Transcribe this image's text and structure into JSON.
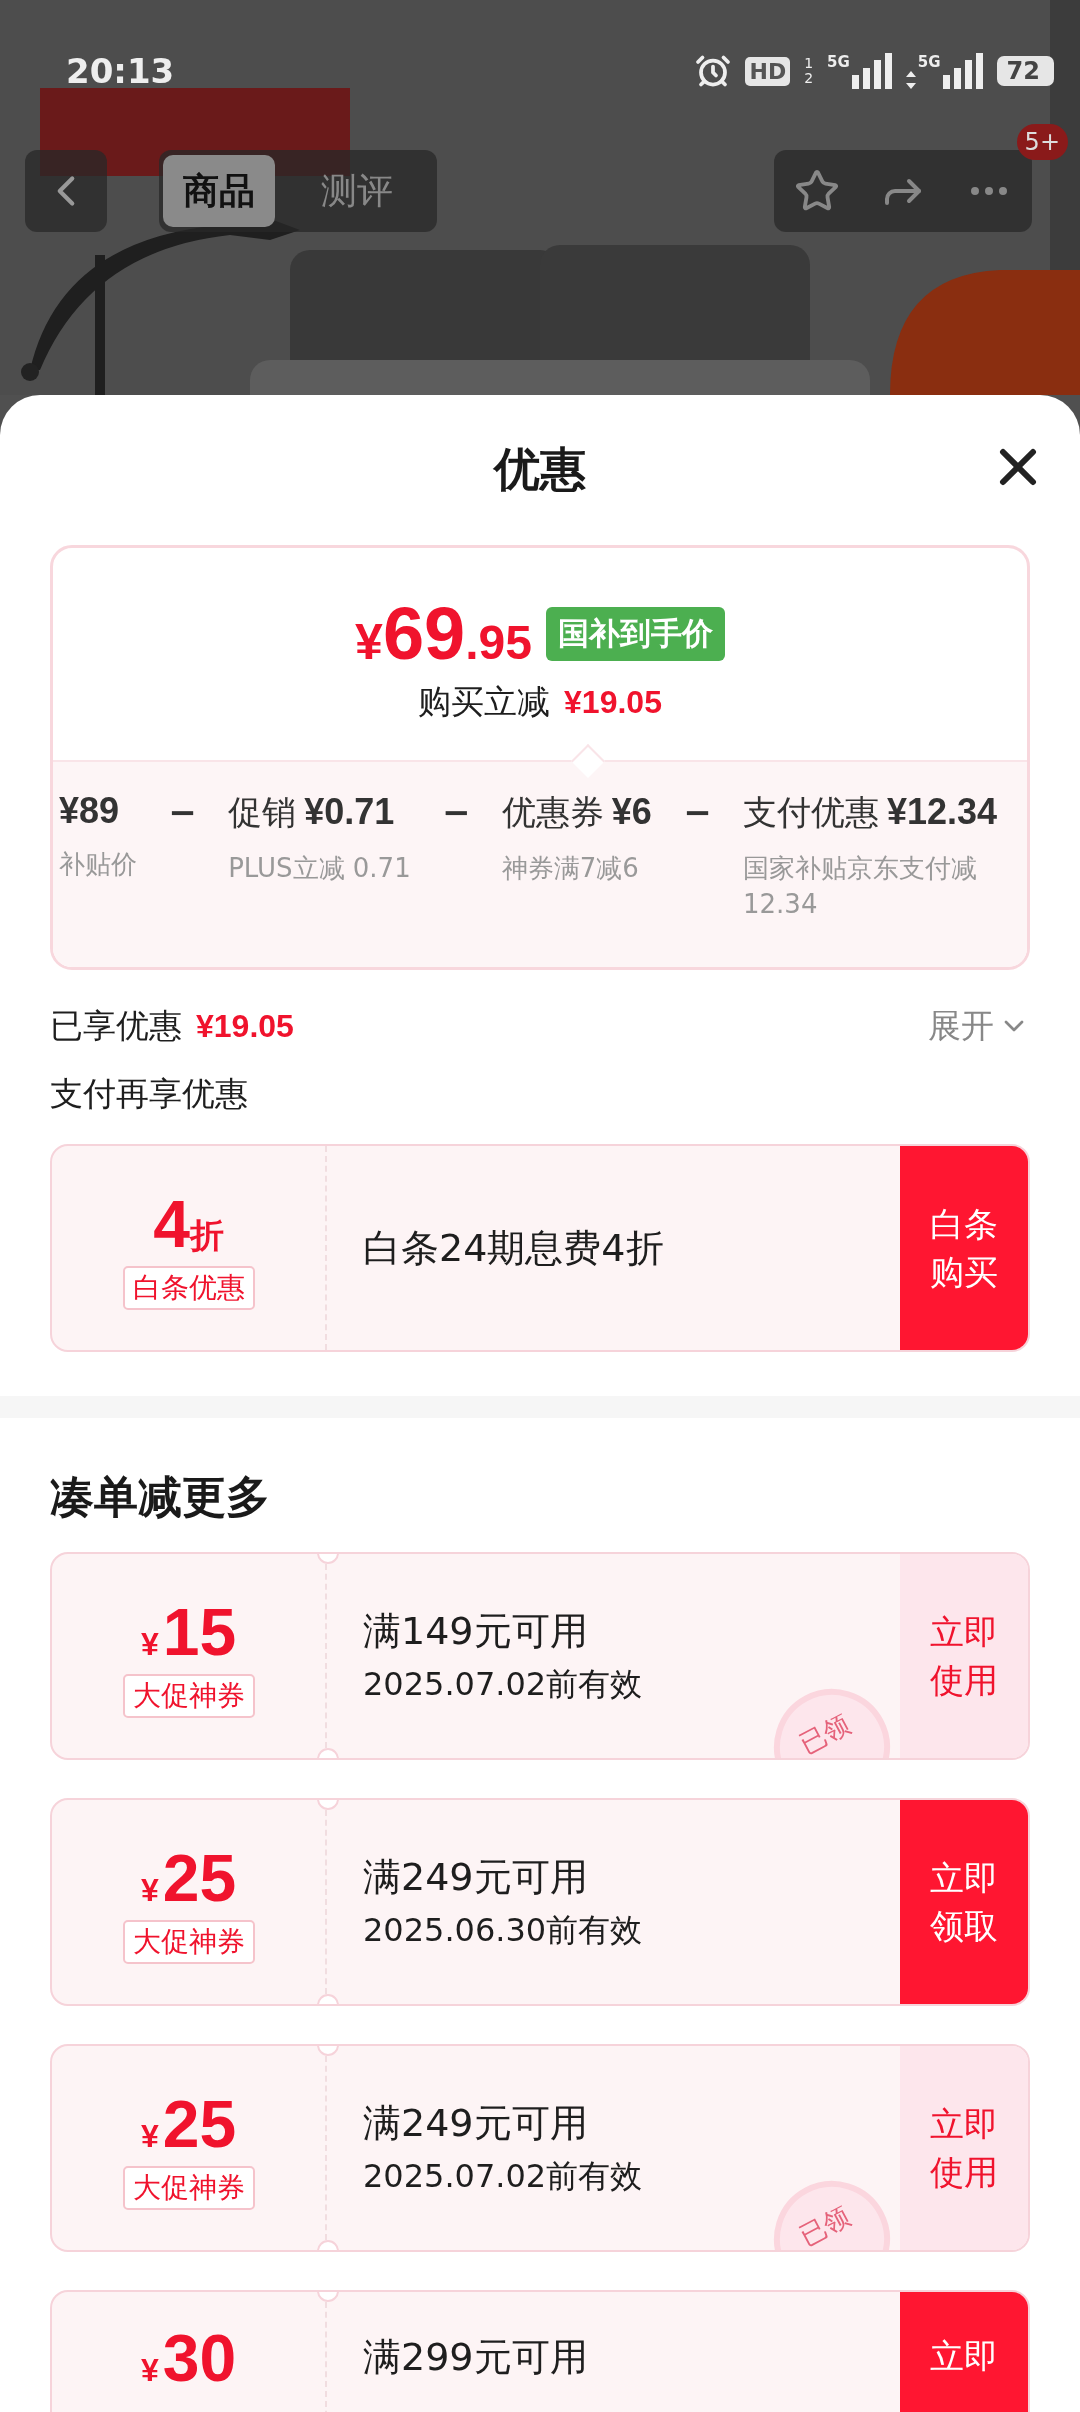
{
  "status_bar": {
    "time": "20:13",
    "hd": "HD",
    "hd_slots": [
      "1",
      "2"
    ],
    "networks": [
      {
        "label": "5G",
        "arrows": false
      },
      {
        "label": "5G",
        "arrows": true
      }
    ],
    "battery": "72"
  },
  "nav": {
    "tabs": [
      {
        "label": "商品",
        "selected": true
      },
      {
        "label": "测评",
        "selected": false
      }
    ],
    "badge": "5+"
  },
  "sheet": {
    "title": "优惠"
  },
  "price_card": {
    "currency": "¥",
    "price_int": "69",
    "price_dec": ".95",
    "tag": "国补到手价",
    "saving_label": "购买立减",
    "saving": "¥19.05",
    "breakdown": [
      {
        "amount": "¥89",
        "note": "补贴价"
      },
      {
        "sep": "−",
        "label": "促销",
        "amount": "¥0.71",
        "note": "PLUS立减 0.71"
      },
      {
        "sep": "−",
        "label": "优惠券",
        "amount": "¥6",
        "note": "神券满7减6"
      },
      {
        "sep": "−",
        "label": "支付优惠",
        "amount": "¥12.34",
        "note": "国家补贴京东支付减 12.34"
      }
    ]
  },
  "enjoyed": {
    "label": "已享优惠",
    "amount": "¥19.05",
    "expand": "展开"
  },
  "pay_section": {
    "title": "支付再享优惠",
    "offer": {
      "value": "4",
      "unit": "折",
      "tag": "白条优惠",
      "text": "白条24期息费4折",
      "button": "白条购买"
    }
  },
  "bundle": {
    "title": "凑单减更多",
    "coupons": [
      {
        "currency": "¥",
        "amount": "15",
        "tag": "大促神券",
        "condition": "满149元可用",
        "validity": "2025.07.02前有效",
        "button": "立即使用",
        "claimed": true,
        "stamp": "已领"
      },
      {
        "currency": "¥",
        "amount": "25",
        "tag": "大促神券",
        "condition": "满249元可用",
        "validity": "2025.06.30前有效",
        "button": "立即领取",
        "claimed": false
      },
      {
        "currency": "¥",
        "amount": "25",
        "tag": "大促神券",
        "condition": "满249元可用",
        "validity": "2025.07.02前有效",
        "button": "立即使用",
        "claimed": true,
        "stamp": "已领"
      },
      {
        "currency": "¥",
        "amount": "30",
        "condition": "满299元可用",
        "button": "立即",
        "claimed": false
      }
    ]
  }
}
